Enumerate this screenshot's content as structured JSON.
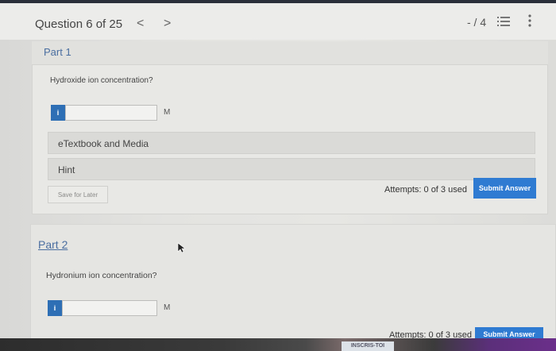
{
  "header": {
    "question": "Question 6 of 25",
    "prev": "<",
    "next": ">",
    "score": "- / 4"
  },
  "part1": {
    "label": "Part 1",
    "question": "Hydroxide ion concentration?",
    "info": "i",
    "input_value": "",
    "unit": "M",
    "etextbook": "eTextbook and Media",
    "hint": "Hint",
    "save": "Save for Later",
    "attempts": "Attempts: 0 of 3 used",
    "submit": "Submit Answer"
  },
  "part2": {
    "label": "Part 2",
    "question": "Hydronium ion concentration?",
    "info": "i",
    "input_value": "",
    "unit": "M",
    "attempts": "Attempts: 0 of 3 used",
    "submit": "Submit Answer"
  },
  "banner": "INSCRIS-TOI",
  "colors": {
    "accent": "#2f7bd2",
    "info": "#2e6fb5",
    "link": "#4a6ea0"
  }
}
